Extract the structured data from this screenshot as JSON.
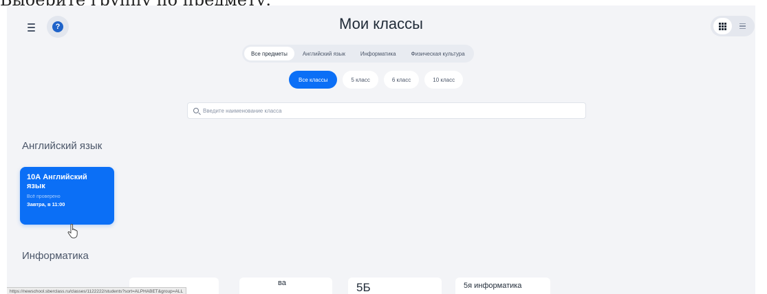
{
  "caption": "Выберите группу по предмету.",
  "header": {
    "title": "Мои классы",
    "help_label": "?"
  },
  "view_toggle": {
    "options": [
      {
        "icon": "grid-view-icon",
        "active": true
      },
      {
        "icon": "list-view-icon",
        "active": false
      }
    ]
  },
  "subject_filter": {
    "items": [
      "Все предметы",
      "Английский язык",
      "Информатика",
      "Физическая культура"
    ],
    "selected": "Все предметы"
  },
  "class_filter": {
    "items": [
      "Все классы",
      "5 класс",
      "6 класс",
      "10 класс"
    ],
    "selected": "Все классы"
  },
  "search": {
    "placeholder": "Введите наименование класса",
    "value": ""
  },
  "sections": [
    {
      "heading": "Английский язык",
      "cards": [
        {
          "title": "10А Английский язык",
          "status": "Всё проверено",
          "next_lesson": "Завтра, в 11:00"
        }
      ]
    },
    {
      "heading": "Информатика",
      "cards": [
        {
          "title": "ва"
        },
        {
          "title": "5Б"
        },
        {
          "title": "5я информатика"
        }
      ]
    }
  ],
  "status_bar": {
    "url": "https://newschool.sberclass.ru/classes/1122222/students?sort=ALPHABET&group=ALL"
  },
  "colors": {
    "accent": "#0b6ff6",
    "background": "#f3f4f7",
    "help_icon": "#1f63c9"
  }
}
